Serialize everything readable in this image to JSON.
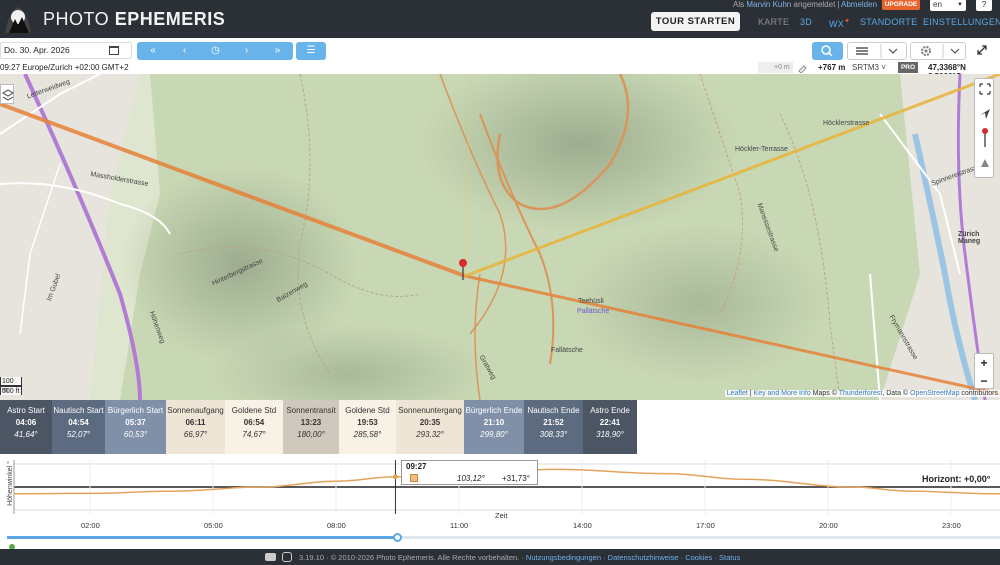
{
  "header": {
    "brand_prefix": "PHOTO ",
    "brand_bold": "EPHEMERIS",
    "user_prefix": "Als ",
    "user_name": "Marvin Kuhn",
    "user_suffix": " angemeldet",
    "separator": "|",
    "logout": "Abmelden",
    "upgrade": "UPGRADE",
    "language": "en",
    "help": "?",
    "tour_button": "TOUR STARTEN",
    "nav": {
      "karte": "KARTE",
      "three_d": "3D",
      "wx": "WX",
      "wx_badge": "✦",
      "standorte": "STANDORTE",
      "einstellungen": "EINSTELLUNGEN"
    }
  },
  "toolbar": {
    "date": "Do. 30. Apr. 2026",
    "buttons": {
      "ff_back": "«",
      "back": "‹",
      "now": "◷",
      "fwd": "›",
      "ff_fwd": "»",
      "menu": "☰"
    }
  },
  "info": {
    "timezone": "09:27 Europe/Zurich +02:00 GMT+2",
    "elev_offset": "+0 m",
    "elevation": "+767 m",
    "dem": "SRTM3",
    "pro": "PRO",
    "coordinates": "47,3368°N 8,5006°O"
  },
  "map": {
    "labels": {
      "letterweidweg": "Letterweidweg",
      "massholderstrasse": "Massholderstrasse",
      "hinterbergstrasse": "Hinterbergstrasse",
      "hohenweg": "Höhenweg",
      "im_gubel": "Im Gubel",
      "teehusli": "Teehüsli",
      "pallatsche": "Pallätsche",
      "fallatsche": "Fallätsche",
      "hocklerterrasse": "Höckler-Terrasse",
      "hocklerstrasse": "Höcklerstrasse",
      "manessestrasse": "Manessestrasse",
      "zurich_manegg": "Zürich Maneg",
      "spinnereistrasse": "Spinnereistrasse",
      "frymannstrasse": "Frymannstrasse",
      "gratweg": "Gratweg",
      "balzenweg": "Balzenweg"
    },
    "scale_m": "100 m",
    "scale_ft": "500 ft",
    "zoom_in": "+",
    "zoom_out": "−",
    "attribution": {
      "leaflet": "Leaflet",
      "sep1": " | ",
      "key": "Key and More Info",
      "maps_by": " Maps © ",
      "thunderforest": "Thunderforest",
      "data": ", Data © ",
      "osm": "OpenStreetMap",
      "contrib": " contributors"
    }
  },
  "phases": [
    {
      "name": "Astro Start",
      "time": "04:06",
      "angle": "41,64°",
      "bg": "#4b5563",
      "style": "dark"
    },
    {
      "name": "Nautisch Start",
      "time": "04:54",
      "angle": "52,07°",
      "bg": "#5d6b80",
      "style": "dark"
    },
    {
      "name": "Bürgerlich Start",
      "time": "05:37",
      "angle": "60,53°",
      "bg": "#7f90a8",
      "style": "dark"
    },
    {
      "name": "Sonnenaufgang",
      "time": "06:11",
      "angle": "66,97°",
      "bg": "#efe5d6",
      "style": "light"
    },
    {
      "name": "Goldene Std",
      "time": "06:54",
      "angle": "74,67°",
      "bg": "#f7f1e6",
      "style": "light"
    },
    {
      "name": "Sonnentransit",
      "time": "13:23",
      "angle": "180,00°",
      "bg": "#cfc8bd",
      "style": "light"
    },
    {
      "name": "Goldene Std",
      "time": "19:53",
      "angle": "285,58°",
      "bg": "#f7f1e6",
      "style": "light"
    },
    {
      "name": "Sonnenuntergang",
      "time": "20:35",
      "angle": "293,32°",
      "bg": "#efe5d6",
      "style": "light"
    },
    {
      "name": "Bürgerlich Ende",
      "time": "21:10",
      "angle": "299,80°",
      "bg": "#7f90a8",
      "style": "dark"
    },
    {
      "name": "Nautisch Ende",
      "time": "21:52",
      "angle": "308,33°",
      "bg": "#5d6b80",
      "style": "dark"
    },
    {
      "name": "Astro Ende",
      "time": "22:41",
      "angle": "318,90°",
      "bg": "#4b5563",
      "style": "dark"
    }
  ],
  "chart": {
    "tooltip_time": "09:27",
    "tooltip_azimuth": "103,12°",
    "tooltip_elevation": "+31,73°",
    "horizon_label": "Horizont: +0,00°",
    "ylabel": "Höhenwinkel °",
    "xlabel": "Zeit",
    "x_ticks": [
      "02:00",
      "05:00",
      "08:00",
      "11:00",
      "14:00",
      "17:00",
      "20:00",
      "23:00"
    ]
  },
  "chart_data": {
    "type": "line",
    "xlabel": "Zeit",
    "ylabel": "Höhenwinkel °",
    "x_ticks": [
      "02:00",
      "05:00",
      "08:00",
      "11:00",
      "14:00",
      "17:00",
      "20:00",
      "23:00"
    ],
    "horizon": 0,
    "series": [
      {
        "name": "",
        "x": [
          0,
          2,
          4,
          6.19,
          8,
          9.45,
          11,
          13.38,
          16,
          18,
          20.58,
          22,
          24
        ],
        "y": [
          -21,
          -20,
          -13,
          0,
          18,
          31.73,
          45,
          55,
          42,
          24,
          0,
          -13,
          -21
        ]
      }
    ],
    "current_time": "09:27"
  },
  "footer": {
    "text": "3.19.10 · © 2010-2026 Photo Ephemeris. Alle Rechte vorbehalten. · ",
    "terms": "Nutzungsbedingungen",
    "dot1": " · ",
    "privacy": "Datenschutzhinweise",
    "dot2": " · ",
    "cookies": "Cookies",
    "dot3": " · ",
    "status": "Status"
  },
  "colors": {
    "nav_bg": "#2b2f36",
    "accent_blue": "#67b3ea",
    "sunrise_line": "#e8b43a",
    "sunset_line": "#e6823a",
    "upgrade": "#e8642c"
  }
}
